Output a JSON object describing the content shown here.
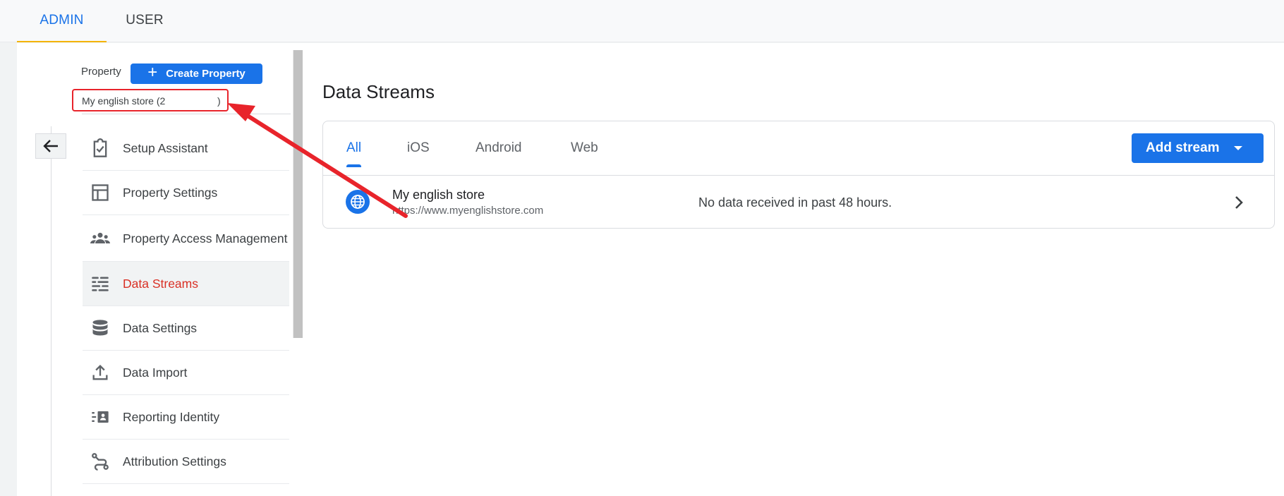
{
  "top_tabs": {
    "admin": "ADMIN",
    "user": "USER"
  },
  "property": {
    "label": "Property",
    "create_button": "Create Property",
    "selected_name": "My english store (2",
    "selected_close": ")"
  },
  "nav": {
    "items": [
      {
        "label": "Setup Assistant",
        "icon": "checklist-icon"
      },
      {
        "label": "Property Settings",
        "icon": "layout-icon"
      },
      {
        "label": "Property Access Management",
        "icon": "people-icon"
      },
      {
        "label": "Data Streams",
        "icon": "streams-icon",
        "active": true
      },
      {
        "label": "Data Settings",
        "icon": "database-icon"
      },
      {
        "label": "Data Import",
        "icon": "upload-icon"
      },
      {
        "label": "Reporting Identity",
        "icon": "identity-icon"
      },
      {
        "label": "Attribution Settings",
        "icon": "attribution-icon"
      }
    ]
  },
  "main": {
    "title": "Data Streams",
    "tabs": [
      "All",
      "iOS",
      "Android",
      "Web"
    ],
    "active_tab": "All",
    "add_stream_button": "Add stream",
    "stream": {
      "name": "My english store",
      "url": "https://www.myenglishstore.com",
      "status": "No data received in past 48 hours."
    }
  },
  "colors": {
    "accent": "#1a73e8",
    "active_nav": "#d93025",
    "annotation": "#e8242b"
  }
}
